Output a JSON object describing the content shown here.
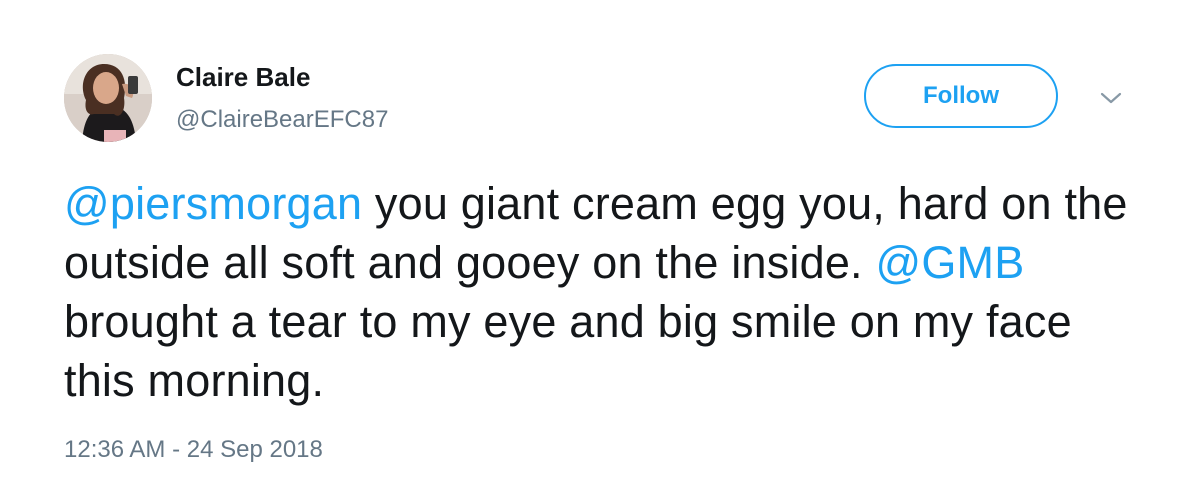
{
  "user": {
    "display_name": "Claire Bale",
    "handle": "@ClaireBearEFC87"
  },
  "actions": {
    "follow_label": "Follow",
    "menu_icon": "chevron-down-icon"
  },
  "tweet": {
    "mention_1": "@piersmorgan",
    "text_1": " you giant cream egg you, hard on the outside all soft and gooey on the inside. ",
    "mention_2": "@GMB",
    "text_2": " brought a tear to my eye and big smile on my face this morning.",
    "timestamp": "12:36 AM - 24 Sep 2018"
  },
  "colors": {
    "link": "#1da1f2",
    "text": "#14171a",
    "muted": "#657786"
  }
}
